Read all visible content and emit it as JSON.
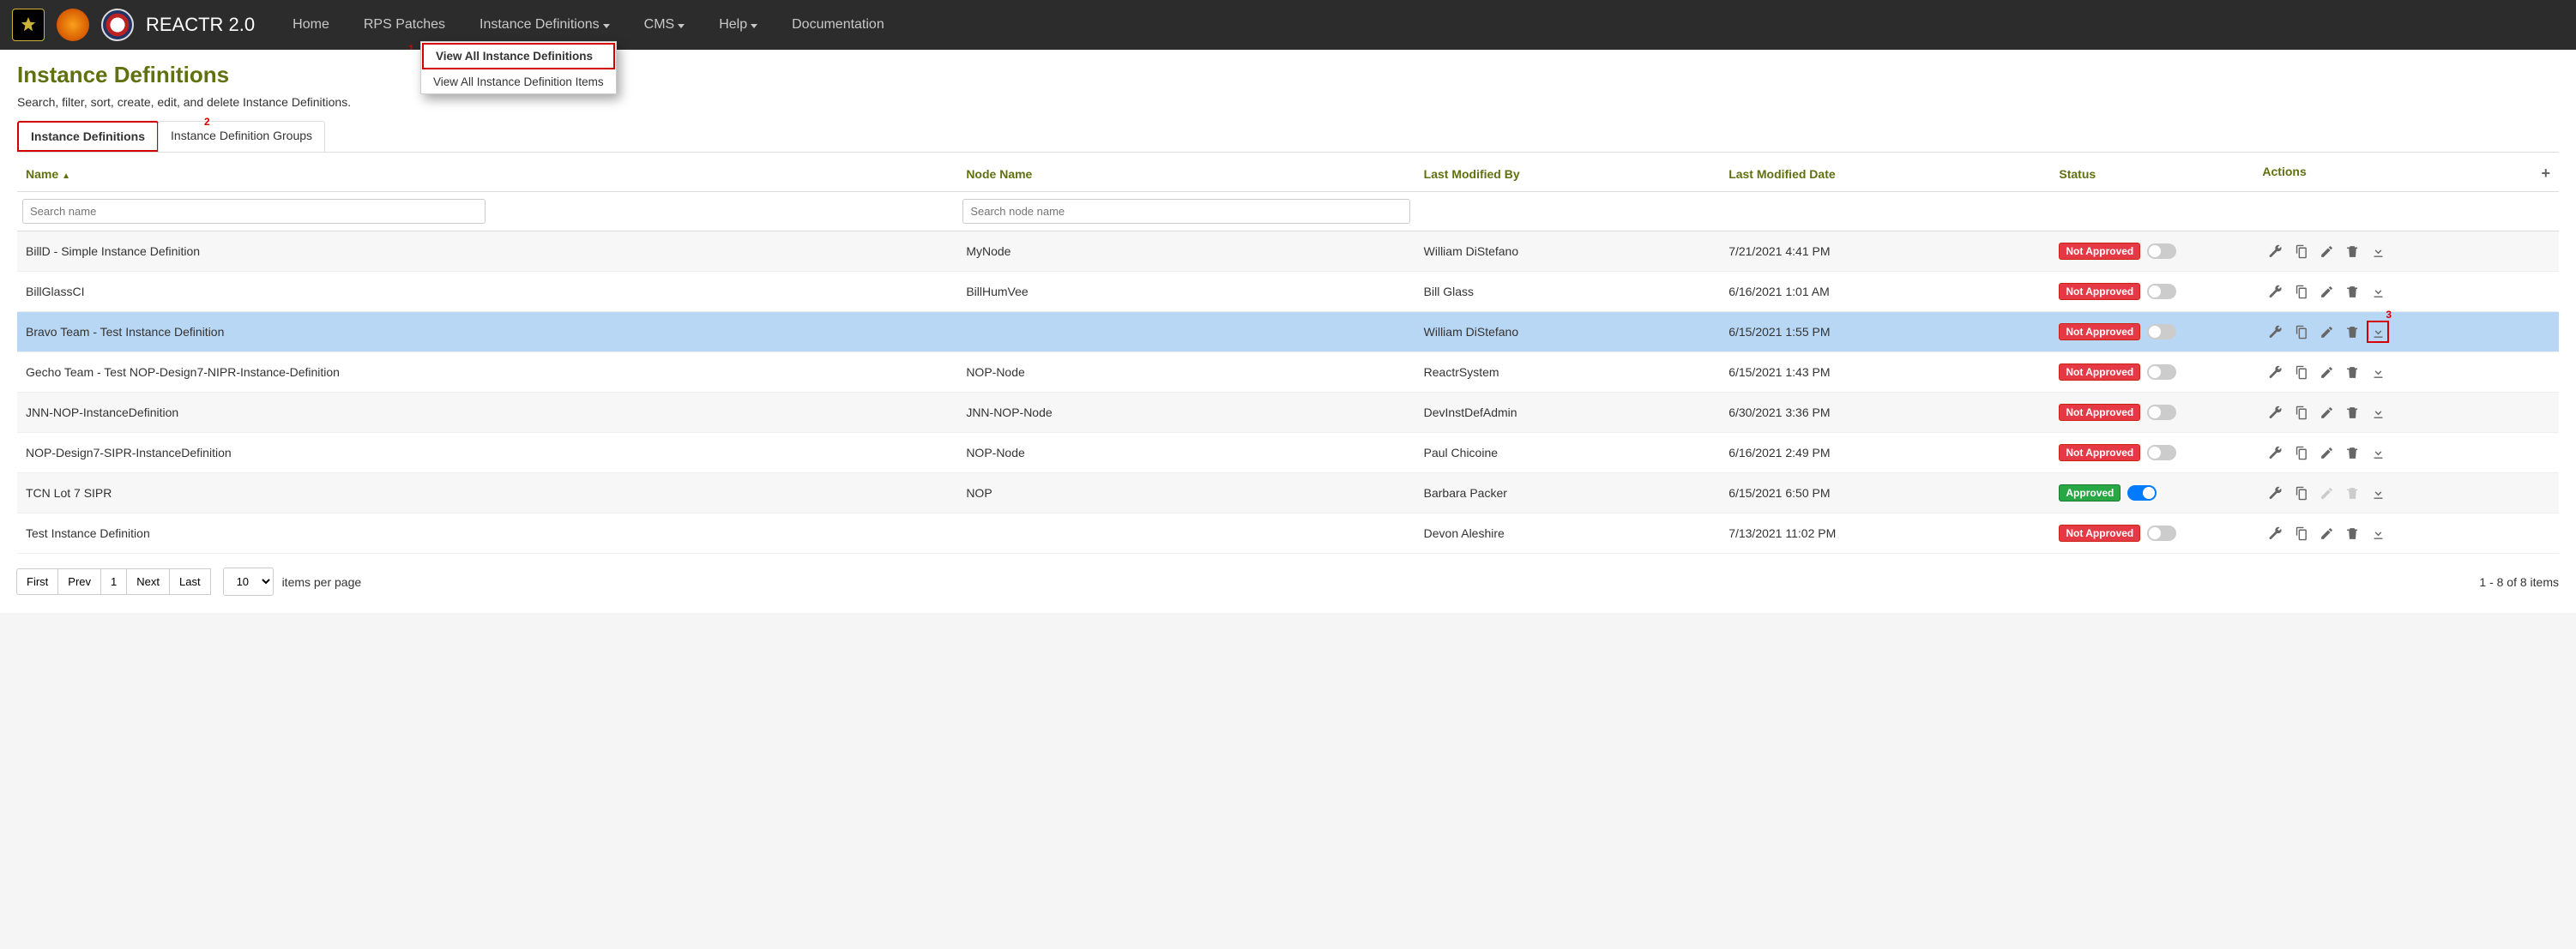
{
  "brand": "REACTR 2.0",
  "nav": {
    "items": [
      "Home",
      "RPS Patches",
      "Instance Definitions",
      "CMS",
      "Help",
      "Documentation"
    ],
    "dropdowns": [
      false,
      false,
      true,
      true,
      true,
      false
    ],
    "open_index": 2,
    "menu": [
      "View All Instance Definitions",
      "View All Instance Definition Items"
    ]
  },
  "annotations": {
    "a1": "1",
    "a2": "2",
    "a3": "3"
  },
  "page": {
    "title": "Instance Definitions",
    "subtitle": "Search, filter, sort, create, edit, and delete Instance Definitions."
  },
  "tabs": [
    "Instance Definitions",
    "Instance Definition Groups"
  ],
  "active_tab": 0,
  "columns": [
    "Name",
    "Node Name",
    "Last Modified By",
    "Last Modified Date",
    "Status",
    "Actions"
  ],
  "sort": {
    "column": 0,
    "dir": "asc"
  },
  "filters": {
    "name_placeholder": "Search name",
    "node_placeholder": "Search node name"
  },
  "status_labels": {
    "not_approved": "Not Approved",
    "approved": "Approved"
  },
  "rows": [
    {
      "name": "BillD - Simple Instance Definition",
      "node": "MyNode",
      "user": "William DiStefano",
      "date": "7/21/2021 4:41 PM",
      "approved": false
    },
    {
      "name": "BillGlassCI",
      "node": "BillHumVee",
      "user": "Bill Glass",
      "date": "6/16/2021 1:01 AM",
      "approved": false
    },
    {
      "name": "Bravo Team - Test Instance Definition",
      "node": "",
      "user": "William DiStefano",
      "date": "6/15/2021 1:55 PM",
      "approved": false,
      "selected": true,
      "download_boxed": true
    },
    {
      "name": "Gecho Team - Test NOP-Design7-NIPR-Instance-Definition",
      "node": "NOP-Node",
      "user": "ReactrSystem",
      "date": "6/15/2021 1:43 PM",
      "approved": false
    },
    {
      "name": "JNN-NOP-InstanceDefinition",
      "node": "JNN-NOP-Node",
      "user": "DevInstDefAdmin",
      "date": "6/30/2021 3:36 PM",
      "approved": false
    },
    {
      "name": "NOP-Design7-SIPR-InstanceDefinition",
      "node": "NOP-Node",
      "user": "Paul Chicoine",
      "date": "6/16/2021 2:49 PM",
      "approved": false
    },
    {
      "name": "TCN Lot 7 SIPR",
      "node": "NOP",
      "user": "Barbara Packer",
      "date": "6/15/2021 6:50 PM",
      "approved": true,
      "edit_disabled": true,
      "delete_disabled": true
    },
    {
      "name": "Test Instance Definition",
      "node": "",
      "user": "Devon Aleshire",
      "date": "7/13/2021 11:02 PM",
      "approved": false
    }
  ],
  "pager": {
    "buttons": [
      "First",
      "Prev",
      "1",
      "Next",
      "Last"
    ],
    "page_size": "10",
    "label": "items per page",
    "range": "1 - 8 of 8 items"
  }
}
